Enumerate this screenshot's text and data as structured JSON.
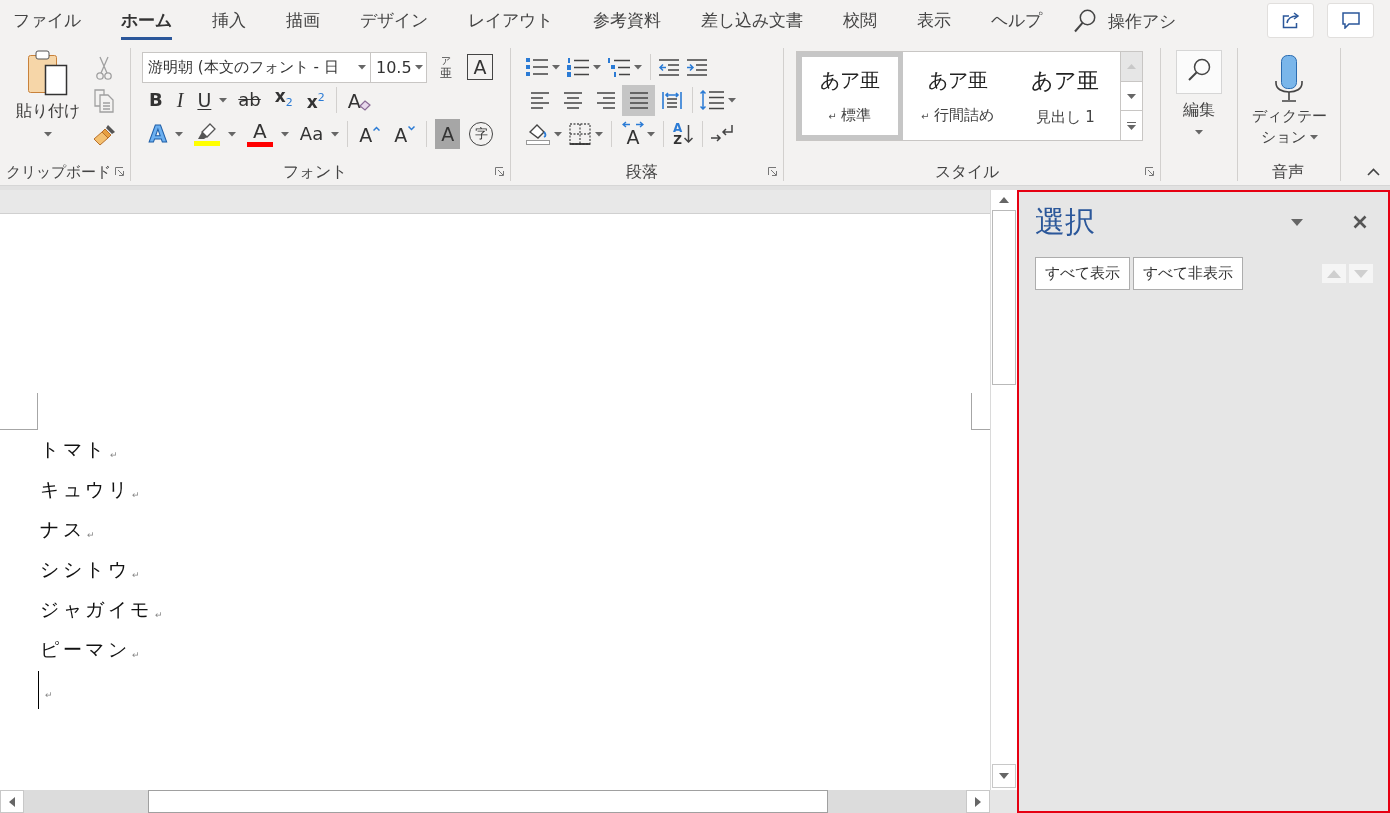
{
  "menu_tabs": [
    {
      "label": "ファイル",
      "selected": false
    },
    {
      "label": "ホーム",
      "selected": true
    },
    {
      "label": "挿入",
      "selected": false
    },
    {
      "label": "描画",
      "selected": false
    },
    {
      "label": "デザイン",
      "selected": false
    },
    {
      "label": "レイアウト",
      "selected": false
    },
    {
      "label": "参考資料",
      "selected": false
    },
    {
      "label": "差し込み文書",
      "selected": false
    },
    {
      "label": "校閲",
      "selected": false
    },
    {
      "label": "表示",
      "selected": false
    },
    {
      "label": "ヘルプ",
      "selected": false
    }
  ],
  "tell_me": {
    "text": "操作アシ"
  },
  "clipboard": {
    "paste_label": "貼り付け",
    "group_label": "クリップボード"
  },
  "font": {
    "name": "游明朝 (本文のフォント - 日",
    "size": "10.5",
    "ruby_text": "ア",
    "ruby_base": "亜",
    "border_glyph": "A",
    "button_rows": [
      [
        {
          "kind": "bold",
          "glyph": "B"
        },
        {
          "kind": "italic",
          "glyph": "I"
        },
        {
          "kind": "underline",
          "glyph": "U"
        },
        {
          "kind": "strike",
          "glyph": "ab"
        },
        {
          "kind": "subscript",
          "glyph": "x$_{2}$"
        },
        {
          "kind": "superscript",
          "glyph": "x$^{2}$"
        },
        {
          "kind": "clear",
          "glyph": "A"
        }
      ],
      [
        {
          "kind": "effects",
          "glyph": "A"
        },
        {
          "kind": "highlight",
          "color": "#ffff00"
        },
        {
          "kind": "fontcolor",
          "glyph": "A",
          "color": "#ff0000"
        },
        {
          "kind": "case",
          "glyph": "Aa"
        },
        {
          "kind": "grow",
          "glyph": "A"
        },
        {
          "kind": "shrink",
          "glyph": "A"
        },
        {
          "kind": "shade",
          "glyph": "A"
        },
        {
          "kind": "enclose",
          "glyph": "字"
        }
      ]
    ],
    "group_label": "フォント"
  },
  "paragraph": {
    "alignments": [
      {
        "kind": "left",
        "selected": false
      },
      {
        "kind": "center",
        "selected": false
      },
      {
        "kind": "right",
        "selected": false
      },
      {
        "kind": "justify",
        "selected": true
      },
      {
        "kind": "distributed",
        "selected": false
      }
    ],
    "direction_glyph": "A",
    "sort_glyphs": [
      "A",
      "Z"
    ],
    "group_label": "段落"
  },
  "styles": {
    "items": [
      {
        "kind": "body",
        "preview": "あア亜",
        "mark": "↵",
        "name": "標準",
        "selected": true
      },
      {
        "kind": "body",
        "preview": "あア亜",
        "mark": "↵",
        "name": "行間詰め",
        "selected": false
      },
      {
        "kind": "heading",
        "preview": "あア亜",
        "name": "見出し 1",
        "selected": false
      }
    ],
    "scroll_up_disabled": true,
    "group_label": "スタイル"
  },
  "editing": {
    "button_label": "編集"
  },
  "voice": {
    "button_label": "ディクテーション",
    "group_label": "音声"
  },
  "document": {
    "paragraphs": [
      {
        "text": "トマト",
        "mark": "↵",
        "cursor": false
      },
      {
        "text": "キュウリ",
        "mark": "↵",
        "cursor": false
      },
      {
        "text": "ナス",
        "mark": "↵",
        "cursor": false
      },
      {
        "text": "シシトウ",
        "mark": "↵",
        "cursor": false
      },
      {
        "text": "ジャガイモ",
        "mark": "↵",
        "cursor": false
      },
      {
        "text": "ピーマン",
        "mark": "↵",
        "cursor": false
      },
      {
        "mark": "↵",
        "cursor": true
      }
    ]
  },
  "selection_pane": {
    "title": "選択",
    "buttons": [
      "すべて表示",
      "すべて非表示"
    ],
    "move_buttons_disabled": true
  }
}
